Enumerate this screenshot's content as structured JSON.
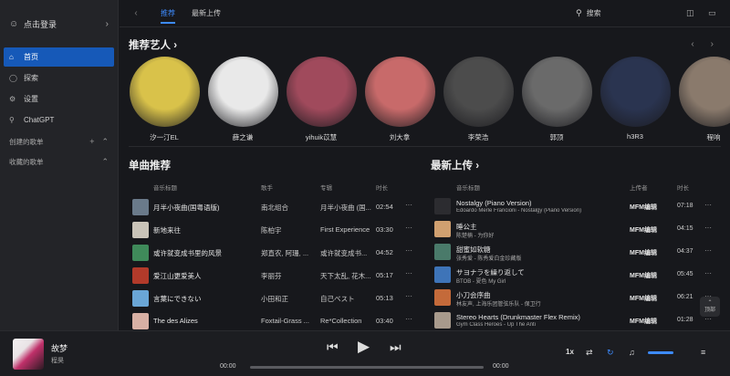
{
  "sidebar": {
    "login_label": "点击登录",
    "items": [
      {
        "label": "首页",
        "icon": "home-icon",
        "active": true
      },
      {
        "label": "探索",
        "icon": "compass-icon",
        "active": false
      },
      {
        "label": "设置",
        "icon": "gear-icon",
        "active": false
      },
      {
        "label": "ChatGPT",
        "icon": "trophy-icon",
        "active": false
      }
    ],
    "created_playlists": "创建的歌单",
    "saved_playlists": "收藏的歌单"
  },
  "topbar": {
    "tabs": [
      {
        "label": "推荐",
        "active": true
      },
      {
        "label": "最新上传",
        "active": false
      }
    ],
    "search_label": "搜索"
  },
  "artists_section": {
    "title": "推荐艺人 ›",
    "artists": [
      {
        "name": "汐一汀EL",
        "color": "#d9c24a"
      },
      {
        "name": "薛之谦",
        "color": "#e9e9e9"
      },
      {
        "name": "yihuik苡慧",
        "color": "#a04a5c"
      },
      {
        "name": "刘大拿",
        "color": "#c86a6a"
      },
      {
        "name": "李荣浩",
        "color": "#4c4c4c"
      },
      {
        "name": "郭顶",
        "color": "#6a6a6a"
      },
      {
        "name": "h3R3",
        "color": "#2a3450"
      },
      {
        "name": "程响",
        "color": "#8a7a6c"
      }
    ]
  },
  "singles": {
    "title": "单曲推荐",
    "headers": {
      "title": "音乐标题",
      "artist": "歌手",
      "album": "专辑",
      "duration": "时长"
    },
    "rows": [
      {
        "title": "月半小夜曲(国粤语版)",
        "artist": "南北组合",
        "album": "月半小夜曲 (国...",
        "duration": "02:54",
        "color": "#6a7a8a"
      },
      {
        "title": "新地来往",
        "artist": "陈柏宇",
        "album": "First Experience",
        "duration": "03:30",
        "color": "#c9c3b8"
      },
      {
        "title": "或许就变成书里的风景",
        "artist": "郑直农, 阿珊, ...",
        "album": "或许就变成书...",
        "duration": "04:52",
        "color": "#3f8a5a"
      },
      {
        "title": "爱江山更爱美人",
        "artist": "李丽芬",
        "album": "天下太乱, 花木...",
        "duration": "05:17",
        "color": "#b23a2a"
      },
      {
        "title": "言葉にできない",
        "artist": "小田和正",
        "album": "自己ベスト",
        "duration": "05:13",
        "color": "#6aa6d6"
      },
      {
        "title": "The des Alizes",
        "artist": "Foxtail-Grass ...",
        "album": "Re*Collection",
        "duration": "03:40",
        "color": "#d8b0a4"
      }
    ]
  },
  "latest": {
    "title": "最新上传 ›",
    "headers": {
      "title": "音乐标题",
      "uploader": "上传者",
      "duration": "时长"
    },
    "rows": [
      {
        "title": "Nostalgy (Piano Version)",
        "sub": "Edoardo Merle Francioni - Nostalgy (Piano Version)",
        "uploader": "MFM编辑",
        "duration": "07:18",
        "color": "#2c2c30"
      },
      {
        "title": "睡公主",
        "sub": "陈楚楠 - 为你好",
        "uploader": "MFM编辑",
        "duration": "04:15",
        "color": "#d0a070"
      },
      {
        "title": "甜蜜如软糖",
        "sub": "张秀爱 - 陈秀爱白金珍藏版",
        "uploader": "MFM编辑",
        "duration": "04:37",
        "color": "#4a7a6a"
      },
      {
        "title": "サヨナラを繰り返して",
        "sub": "BTOB - 夏色 My Girl",
        "uploader": "MFM编辑",
        "duration": "05:45",
        "color": "#3e74b8"
      },
      {
        "title": "小刀会序曲",
        "sub": "林友声, 上海乐团管弦乐队 - 保卫行",
        "uploader": "MFM编辑",
        "duration": "06:21",
        "color": "#c46a3a"
      },
      {
        "title": "Stereo Hearts (Drunkmaster Flex Remix)",
        "sub": "Gym Class Heroes - Up The Anti",
        "uploader": "MFM编辑",
        "duration": "01:28",
        "color": "#a89a8c"
      }
    ]
  },
  "scroll_top_label": "顶部",
  "player": {
    "title": "故梦",
    "artist": "程昊",
    "current_time": "00:00",
    "total_time": "00:00",
    "speed": "1x"
  }
}
